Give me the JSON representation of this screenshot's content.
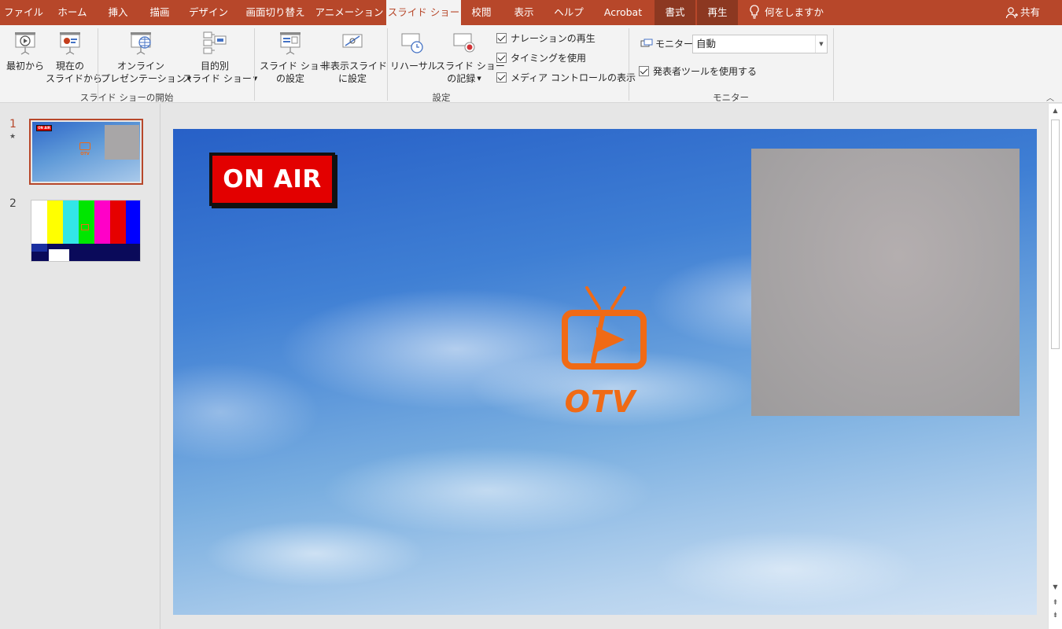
{
  "tabs": [
    {
      "label": "ファイル"
    },
    {
      "label": "ホーム"
    },
    {
      "label": "挿入"
    },
    {
      "label": "描画"
    },
    {
      "label": "デザイン"
    },
    {
      "label": "画面切り替え"
    },
    {
      "label": "アニメーション"
    },
    {
      "label": "スライド ショー",
      "active": true
    },
    {
      "label": "校閲"
    },
    {
      "label": "表示"
    },
    {
      "label": "ヘルプ"
    },
    {
      "label": "Acrobat"
    },
    {
      "label": "書式",
      "contextual": true
    },
    {
      "label": "再生",
      "contextual": true
    }
  ],
  "tell_me": "何をしますか",
  "share": "共有",
  "ribbon": {
    "start_group": {
      "label": "スライド ショーの開始",
      "from_beginning": {
        "line1": "最初から",
        "line2": ""
      },
      "from_current": {
        "line1": "現在の",
        "line2": "スライドから"
      },
      "online": {
        "line1": "オンライン",
        "line2": "プレゼンテーション"
      },
      "custom": {
        "line1": "目的別",
        "line2": "スライド ショー"
      }
    },
    "setup_group": {
      "label": "設定",
      "setup": {
        "line1": "スライド ショー",
        "line2": "の設定"
      },
      "hide": {
        "line1": "非表示スライド",
        "line2": "に設定"
      },
      "rehearse": {
        "line1": "リハーサル",
        "line2": ""
      },
      "record": {
        "line1": "スライド ショー",
        "line2": "の記録"
      },
      "checks": [
        {
          "label": "ナレーションの再生",
          "checked": true
        },
        {
          "label": "タイミングを使用",
          "checked": true
        },
        {
          "label": "メディア コントロールの表示",
          "checked": true
        }
      ]
    },
    "monitor_group": {
      "label": "モニター",
      "monitor_label": "モニター:",
      "monitor_value": "自動",
      "presenter_view": {
        "label": "発表者ツールを使用する",
        "checked": true
      }
    }
  },
  "thumbnails": [
    {
      "number": "1",
      "selected": true,
      "has_animation": true
    },
    {
      "number": "2",
      "selected": false
    }
  ],
  "slide": {
    "badge": "ON AIR",
    "logo_text": "OTV",
    "colors": {
      "badge_bg": "#e30000",
      "logo": "#f06a15",
      "sky_top": "#2760c7",
      "sky_bottom": "#d3e3f4"
    }
  },
  "colors": {
    "ribbon_tab": "#b7472a",
    "contextual_tab": "#8c3821"
  }
}
